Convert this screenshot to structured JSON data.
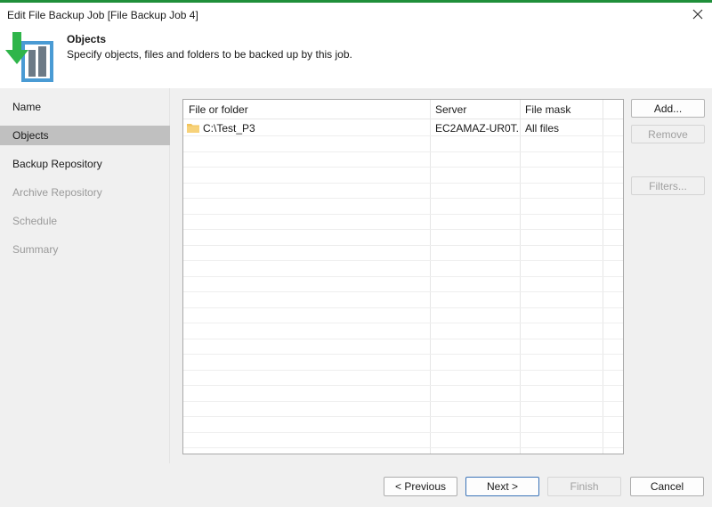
{
  "window": {
    "title": "Edit File Backup Job [File Backup Job 4]",
    "close_icon": "close-icon"
  },
  "header": {
    "title": "Objects",
    "subtitle": "Specify objects, files and folders to be backed up by this job.",
    "logo_icon": "backup-job-icon"
  },
  "nav": {
    "items": [
      {
        "label": "Name",
        "state": "normal"
      },
      {
        "label": "Objects",
        "state": "active"
      },
      {
        "label": "Backup Repository",
        "state": "normal"
      },
      {
        "label": "Archive Repository",
        "state": "disabled"
      },
      {
        "label": "Schedule",
        "state": "disabled"
      },
      {
        "label": "Summary",
        "state": "disabled"
      }
    ]
  },
  "grid": {
    "columns": [
      "File or folder",
      "Server",
      "File mask"
    ],
    "rows": [
      {
        "path": "C:\\Test_P3",
        "server": "EC2AMAZ-UR0T...",
        "mask": "All files",
        "icon": "folder-icon"
      }
    ]
  },
  "side_buttons": {
    "add": "Add...",
    "remove": "Remove",
    "filters": "Filters..."
  },
  "footer": {
    "previous": "< Previous",
    "next": "Next >",
    "finish": "Finish",
    "cancel": "Cancel"
  },
  "colors": {
    "accent": "#1f8f3a",
    "folder": "#f2c45a",
    "primary_border": "#3c74b8",
    "selected_nav": "#c0c0c0"
  }
}
